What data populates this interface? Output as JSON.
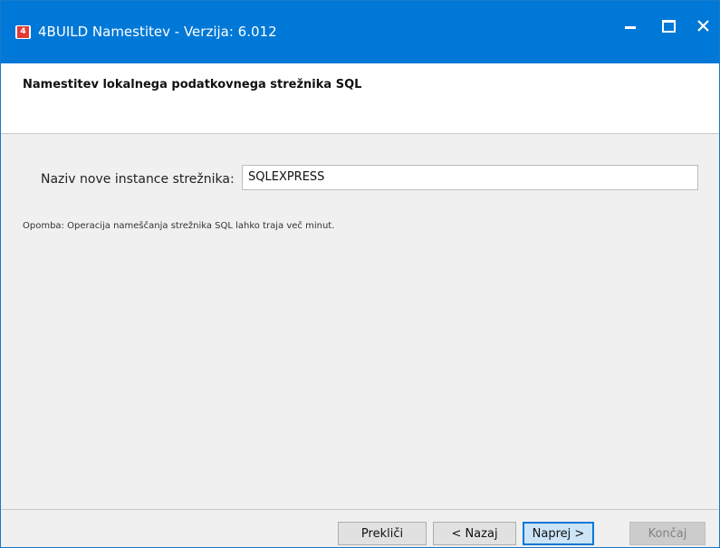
{
  "window": {
    "title": "4BUILD Namestitev - Verzija: 6.012",
    "app_icon": "4B-logo-icon",
    "controls": {
      "minimize": "minimize-icon",
      "maximize": "maximize-icon",
      "close": "close-icon"
    },
    "colors": {
      "titlebar": "#0078d7",
      "logo": "#e23a35"
    }
  },
  "header": {
    "title": "Namestitev lokalnega podatkovnega strežnika SQL"
  },
  "form": {
    "instance_label": "Naziv nove instance strežnika:",
    "instance_value": "SQLEXPRESS",
    "note": "Opomba: Operacija nameščanja strežnika SQL lahko traja več minut."
  },
  "buttons": {
    "cancel": "Prekliči",
    "back": "< Nazaj",
    "next": "Naprej >",
    "finish": "Končaj"
  }
}
